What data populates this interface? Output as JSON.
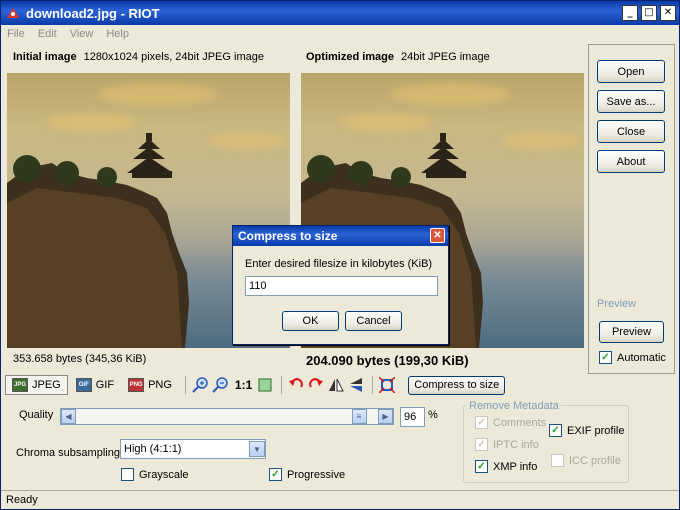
{
  "window": {
    "title": "download2.jpg - RIOT",
    "minimize": "_",
    "maximize": "□",
    "close": "✕"
  },
  "menu": [
    "File",
    "Edit",
    "View",
    "Help"
  ],
  "initial": {
    "label": "Initial image",
    "info": "1280x1024 pixels, 24bit JPEG image",
    "size": "353.658 bytes (345,36 KiB)"
  },
  "optimized": {
    "label": "Optimized image",
    "info": "24bit JPEG image",
    "size": "204.090 bytes (199,30 KiB)"
  },
  "side": {
    "open": "Open",
    "save_as": "Save as...",
    "close": "Close",
    "about": "About",
    "preview_group": "Preview",
    "preview_btn": "Preview",
    "automatic": "Automatic"
  },
  "toolbar": {
    "tab_jpeg": "JPEG",
    "tab_gif": "GIF",
    "tab_png": "PNG",
    "zoom_11": "1:1",
    "compress": "Compress to size"
  },
  "jpeg": {
    "quality_label": "Quality",
    "quality_value": "96",
    "percent": "%",
    "quality_fraction": 0.96,
    "chroma_label": "Chroma subsampling",
    "chroma_value": "High (4:1:1)",
    "grayscale": "Grayscale",
    "progressive": "Progressive"
  },
  "metadata": {
    "title": "Remove Metadata",
    "comments": "Comments",
    "iptc": "IPTC info",
    "exif": "EXIF profile",
    "xmp": "XMP info",
    "icc": "ICC profile"
  },
  "status": "Ready",
  "dialog": {
    "title": "Compress to size",
    "prompt": "Enter desired filesize in kilobytes (KiB)",
    "value": "110",
    "ok": "OK",
    "cancel": "Cancel"
  },
  "icons": {
    "app": "riot-app-icon",
    "zoom_in": "zoom-in-icon",
    "zoom_out": "zoom-out-icon",
    "fit": "fit-window-icon",
    "rotate_left": "rotate-left-icon",
    "rotate_right": "rotate-right-icon",
    "flip_h": "flip-horizontal-icon",
    "flip_v": "flip-vertical-icon",
    "crop": "crop-icon"
  }
}
